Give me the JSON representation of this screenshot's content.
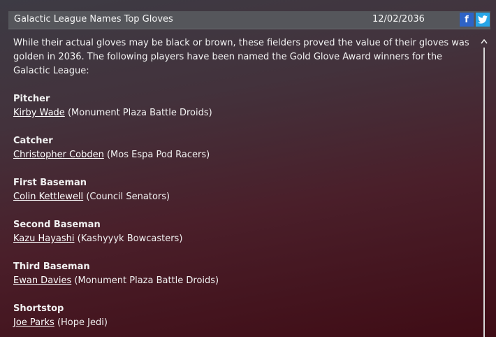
{
  "header": {
    "title": "Galactic League Names Top Gloves",
    "date": "12/02/2036",
    "facebook_label": "f"
  },
  "article": {
    "intro": "While their actual gloves may be black or brown, these fielders proved the value of their gloves was golden in 2036. The following players have been named the Gold Glove Award winners for the  Galactic League:",
    "awards": [
      {
        "position": "Pitcher",
        "player": "Kirby Wade",
        "team": "(Monument Plaza Battle Droids)"
      },
      {
        "position": "Catcher",
        "player": "Christopher Cobden",
        "team": "(Mos Espa Pod Racers)"
      },
      {
        "position": "First Baseman",
        "player": "Colin Kettlewell",
        "team": "(Council Senators)"
      },
      {
        "position": "Second Baseman",
        "player": "Kazu Hayashi",
        "team": "(Kashyyyk Bowcasters)"
      },
      {
        "position": "Third Baseman",
        "player": "Ewan Davies",
        "team": "(Monument Plaza Battle Droids)"
      },
      {
        "position": "Shortstop",
        "player": "Joe Parks",
        "team": "(Hope Jedi)"
      }
    ]
  },
  "colors": {
    "facebook": "#2e63c6",
    "twitter": "#27a6e8",
    "header_bg": "#55565b"
  }
}
